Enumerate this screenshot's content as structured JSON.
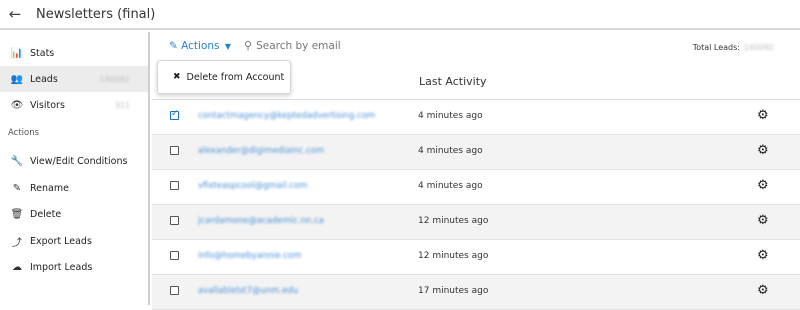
{
  "header": {
    "back_icon": "←",
    "title": "Newsletters (final)"
  },
  "sidebar": {
    "items": [
      {
        "label": "Stats",
        "icon": "📊"
      },
      {
        "label": "Leads",
        "icon": "👥",
        "count": "140092"
      },
      {
        "label": "Visitors",
        "icon": "👁",
        "count": "311"
      }
    ],
    "section_title": "Actions",
    "actions": [
      {
        "label": "View/Edit Conditions",
        "icon": "🔧"
      },
      {
        "label": "Rename",
        "icon": "✎"
      },
      {
        "label": "Delete",
        "icon": "🗑"
      },
      {
        "label": "Export Leads",
        "icon": "⤴"
      },
      {
        "label": "Import Leads",
        "icon": "☁"
      }
    ]
  },
  "toolbar": {
    "actions_label": "Actions",
    "search_placeholder": "Search by email",
    "total_label": "Total Leads:",
    "total_value": "140092"
  },
  "dropdown": {
    "items": [
      {
        "label": "Delete from Account"
      }
    ]
  },
  "table": {
    "columns": {
      "last_activity": "Last Activity"
    },
    "rows": [
      {
        "email": "contactmagency@keptedadvertising.com",
        "last_activity": "4 minutes ago",
        "checked": true
      },
      {
        "email": "alexander@digimediainc.com",
        "last_activity": "4 minutes ago",
        "checked": false
      },
      {
        "email": "vfixteaspcool@gmail.com",
        "last_activity": "4 minutes ago",
        "checked": false
      },
      {
        "email": "jcardamone@academic.nn.ca",
        "last_activity": "12 minutes ago",
        "checked": false
      },
      {
        "email": "info@homebyannie.com",
        "last_activity": "12 minutes ago",
        "checked": false
      },
      {
        "email": "avallablelst7@unm.edu",
        "last_activity": "17 minutes ago",
        "checked": false
      }
    ]
  }
}
